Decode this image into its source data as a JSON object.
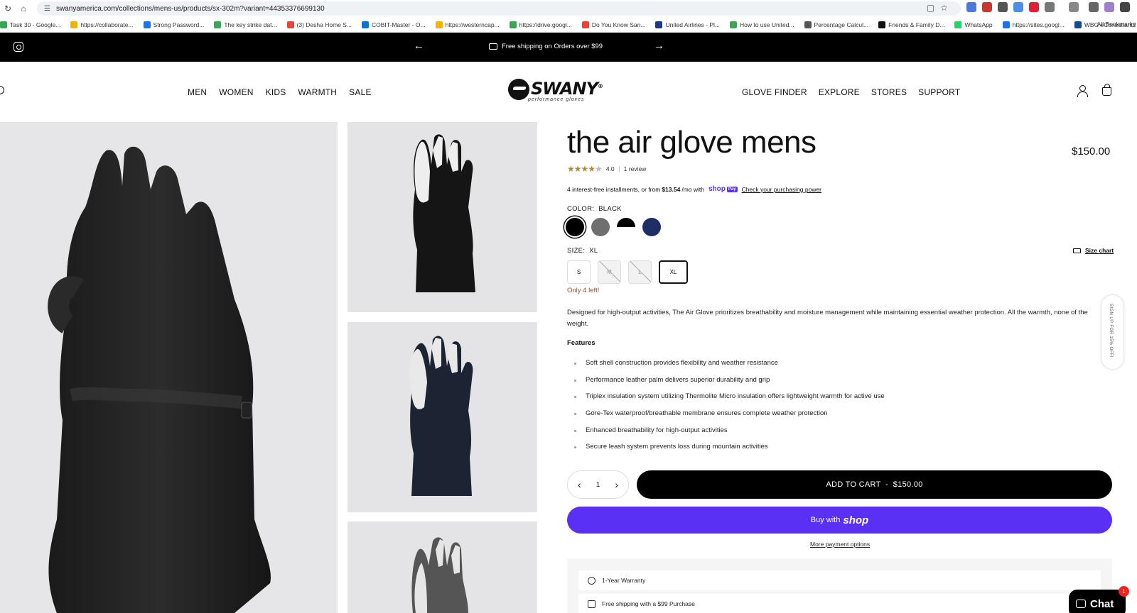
{
  "browser": {
    "url": "swanyamerica.com/collections/mens-us/products/sx-302m?variant=44353376699130",
    "bookmarks": [
      {
        "label": "Task 30 - Google...",
        "color": "#34a853"
      },
      {
        "label": "https://collaborate...",
        "color": "#f4b400"
      },
      {
        "label": "Strong Password...",
        "color": "#1a73e8"
      },
      {
        "label": "The key strike dat...",
        "color": "#3aa757"
      },
      {
        "label": "(3) Desha Home S...",
        "color": "#ea4335"
      },
      {
        "label": "COBIT-Master - O...",
        "color": "#0078d4"
      },
      {
        "label": "https://westerncap...",
        "color": "#f4b400"
      },
      {
        "label": "https://drive.googl...",
        "color": "#34a853"
      },
      {
        "label": "Do You Know San...",
        "color": "#ea4335"
      },
      {
        "label": "United Airlines - Pl...",
        "color": "#1a3a8a"
      },
      {
        "label": "How to use United...",
        "color": "#3aa757"
      },
      {
        "label": "Percentage Calcul...",
        "color": "#555555"
      },
      {
        "label": "Friends & Family D...",
        "color": "#111111"
      },
      {
        "label": "WhatsApp",
        "color": "#25d366"
      },
      {
        "label": "https://sites.googl...",
        "color": "#1a73e8"
      },
      {
        "label": "WBG eConsultant2",
        "color": "#0a4da2"
      }
    ],
    "bookmarks_more": "»",
    "all_bookmarks": "All Bookmarks"
  },
  "announcement": {
    "prev_arrow": "←",
    "next_arrow": "→",
    "message": "Free shipping on Orders over $99"
  },
  "header": {
    "nav_left": [
      "MEN",
      "WOMEN",
      "KIDS",
      "WARMTH",
      "SALE"
    ],
    "nav_right": [
      "GLOVE FINDER",
      "EXPLORE",
      "STORES",
      "SUPPORT"
    ],
    "logo_word": "SWANY",
    "logo_reg": "®",
    "logo_tagline": "performance gloves"
  },
  "product": {
    "title": "the air glove mens",
    "price": "$150.00",
    "rating_value": "4.0",
    "rating_stars": 4,
    "review_count": "1 review",
    "installments_pre": "4 interest-free installments, or from",
    "installments_amount": "$13.54",
    "installments_post": "/mo with",
    "shop_label": "shop",
    "pay_label": "Pay",
    "check_power": "Check your purchasing power",
    "color_label": "COLOR:",
    "color_value": "BLACK",
    "swatches": [
      {
        "name": "black",
        "color": "#000000",
        "selected": true
      },
      {
        "name": "grey",
        "color": "#6f6f6f",
        "selected": false
      },
      {
        "name": "black-white",
        "color": "#000000",
        "selected": false
      },
      {
        "name": "navy",
        "color": "#1f2f66",
        "selected": false
      }
    ],
    "size_label": "SIZE:",
    "size_value": "XL",
    "size_chart": "Size chart",
    "sizes": [
      {
        "label": "S",
        "available": true,
        "selected": false
      },
      {
        "label": "M",
        "available": false,
        "selected": false
      },
      {
        "label": "L",
        "available": false,
        "selected": false
      },
      {
        "label": "XL",
        "available": true,
        "selected": true
      }
    ],
    "stock_note": "Only 4 left!",
    "description": "Designed for high-output activities, The Air Glove prioritizes breathability and moisture management while maintaining essential weather protection. All the warmth, none of the weight.",
    "features_title": "Features",
    "features": [
      "Soft shell construction provides flexibility and weather resistance",
      "Performance leather palm delivers superior durability and grip",
      "Triplex insulation system utilizing Thermolite Micro insulation offers lightweight warmth for active use",
      "Gore-Tex waterproof/breathable membrane ensures complete weather protection",
      "Enhanced breathability for high-output activities",
      "Secure leash system prevents loss during mountain activities"
    ],
    "quantity": "1",
    "qty_minus": "‹",
    "qty_plus": "›",
    "add_to_cart": "ADD TO CART  -  $150.00",
    "buy_with": "Buy with",
    "buy_shop": "shop",
    "more_payment": "More payment options",
    "perks": [
      "1-Year Warranty",
      "Free shipping with a $99 Purchase"
    ]
  },
  "widgets": {
    "signup_tab": "SIGN UP FOR 15% OFF!",
    "chat_label": "Chat",
    "chat_badge": "1"
  },
  "colors": {
    "shop_purple": "#5a31f4",
    "stock_orange": "#a0481a",
    "star_gold": "#b08b3a"
  }
}
